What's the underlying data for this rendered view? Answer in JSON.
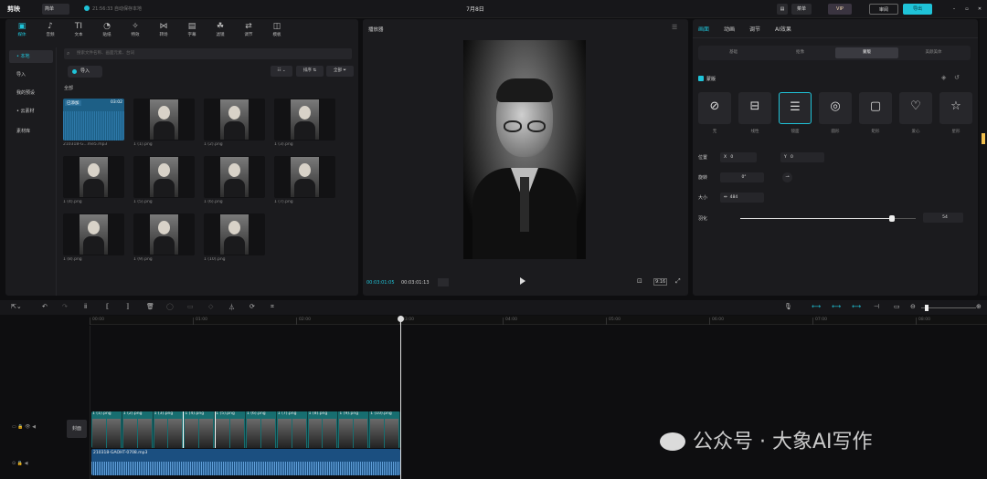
{
  "app": {
    "logo": "剪映",
    "account": "简单",
    "autosave": "21:56:33 自动保存本地",
    "project_title": "7月8日"
  },
  "top_right": {
    "btn1": "菜单",
    "vip": "VIP",
    "review": "审阅",
    "export": "导出"
  },
  "toolbar": [
    {
      "label": "媒体",
      "icon": "▣",
      "name": "media"
    },
    {
      "label": "音频",
      "icon": "♪",
      "name": "audio"
    },
    {
      "label": "文本",
      "icon": "TI",
      "name": "text"
    },
    {
      "label": "贴纸",
      "icon": "◔",
      "name": "sticker"
    },
    {
      "label": "特效",
      "icon": "✧",
      "name": "effect"
    },
    {
      "label": "转场",
      "icon": "⋈",
      "name": "transition"
    },
    {
      "label": "字幕",
      "icon": "▤",
      "name": "subtitle"
    },
    {
      "label": "滤镜",
      "icon": "☘",
      "name": "filter"
    },
    {
      "label": "调节",
      "icon": "⇄",
      "name": "adjust"
    },
    {
      "label": "模板",
      "icon": "◫",
      "name": "template"
    }
  ],
  "sidenav": [
    {
      "label": "• 本地",
      "active": true
    },
    {
      "label": "导入",
      "active": false
    },
    {
      "label": "我的预设",
      "active": false
    },
    {
      "label": "• 云素材",
      "active": false
    },
    {
      "label": "素材库",
      "active": false
    }
  ],
  "search": {
    "placeholder": "搜索文件名称、画面元素、台词"
  },
  "media": {
    "import_label": "导入",
    "view_label": "☷ ⌄",
    "sort_label": "排序 ⇅",
    "filter_label": "全部 ⏷",
    "section": "全部",
    "items": [
      {
        "caption": "210318-G...me5.mp3",
        "type": "audio",
        "badge": "已添加",
        "duration": "03:02"
      },
      {
        "caption": "1 (1).png",
        "type": "image"
      },
      {
        "caption": "1 (2).png",
        "type": "image"
      },
      {
        "caption": "1 (3).png",
        "type": "image"
      },
      {
        "caption": "1 (4).png",
        "type": "image"
      },
      {
        "caption": "1 (5).png",
        "type": "image"
      },
      {
        "caption": "1 (6).png",
        "type": "image"
      },
      {
        "caption": "1 (7).png",
        "type": "image"
      },
      {
        "caption": "1 (8).png",
        "type": "image"
      },
      {
        "caption": "1 (9).png",
        "type": "image"
      },
      {
        "caption": "1 (10).png",
        "type": "image"
      }
    ]
  },
  "player": {
    "title": "播放器",
    "current": "00:03:01:05",
    "total": "00:03:01:13",
    "ratio": "9:16"
  },
  "props": {
    "tabs": [
      "画面",
      "动画",
      "调节",
      "AI效果"
    ],
    "segments": [
      "基础",
      "抠像",
      "蒙版",
      "美颜美体"
    ],
    "mask_header": "蒙版",
    "masks": [
      {
        "label": "无",
        "glyph": "⊘"
      },
      {
        "label": "线性",
        "glyph": "⊟"
      },
      {
        "label": "镜面",
        "glyph": "☰"
      },
      {
        "label": "圆形",
        "glyph": "◎"
      },
      {
        "label": "矩形",
        "glyph": "▢"
      },
      {
        "label": "爱心",
        "glyph": "♡"
      },
      {
        "label": "星形",
        "glyph": "☆"
      }
    ],
    "position_label": "位置",
    "x_label": "X",
    "x_value": "0",
    "y_label": "Y",
    "y_value": "0",
    "rotate_label": "旋转",
    "rotate_value": "0°",
    "size_label": "大小",
    "size_icon": "⇔",
    "size_value": "484",
    "feather_label": "羽化",
    "feather_value": "54",
    "feather_fraction": 0.54
  },
  "ruler": [
    "00:00",
    "01:00",
    "02:00",
    "03:00",
    "04:00",
    "05:00",
    "06:00",
    "07:00",
    "08:00"
  ],
  "track1": [
    "1 (1).png",
    "1 (2).png",
    "1 (3).png",
    "1 (4).png",
    "1 (5).png",
    "1 (6).png",
    "1 (7).png",
    "1 (8).png",
    "1 (9).png",
    "1 (10).png"
  ],
  "track2": {
    "name": "210318-GAOHT-0708.mp3"
  },
  "cover_label": "封面",
  "watermark": "公众号 · 大象AI写作"
}
